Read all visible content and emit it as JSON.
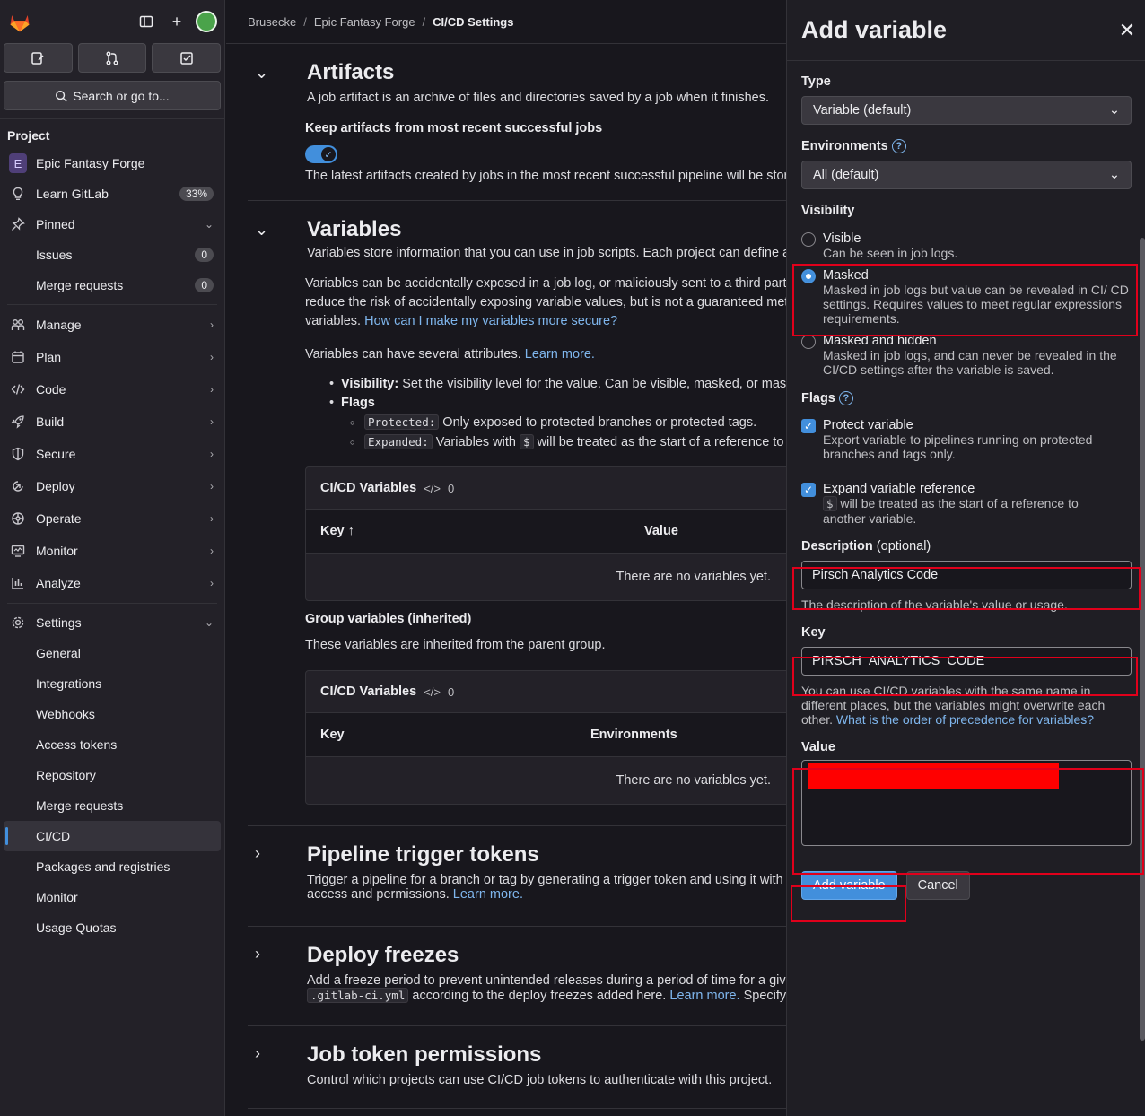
{
  "sidebar": {
    "search_label": "Search or go to...",
    "section_title": "Project",
    "project_name": "Epic Fantasy Forge",
    "project_letter": "E",
    "learn": {
      "label": "Learn GitLab",
      "badge": "33%"
    },
    "pinned": {
      "label": "Pinned",
      "items": [
        {
          "label": "Issues",
          "badge": "0"
        },
        {
          "label": "Merge requests",
          "badge": "0"
        }
      ]
    },
    "groups": [
      "Manage",
      "Plan",
      "Code",
      "Build",
      "Secure",
      "Deploy",
      "Operate",
      "Monitor",
      "Analyze"
    ],
    "settings": {
      "label": "Settings",
      "items": [
        "General",
        "Integrations",
        "Webhooks",
        "Access tokens",
        "Repository",
        "Merge requests",
        "CI/CD",
        "Packages and registries",
        "Monitor",
        "Usage Quotas"
      ]
    },
    "active_item": "CI/CD"
  },
  "breadcrumb": [
    "Brusecke",
    "Epic Fantasy Forge",
    "CI/CD Settings"
  ],
  "artifacts": {
    "title": "Artifacts",
    "desc": "A job artifact is an archive of files and directories saved by a job when it finishes.",
    "keep_label": "Keep artifacts from most recent successful jobs",
    "keep_help": "The latest artifacts created by jobs in the most recent successful pipeline will be stor"
  },
  "variables": {
    "title": "Variables",
    "desc": "Variables store information that you can use in job scripts. Each project can define a",
    "p1_line1": "Variables can be accidentally exposed in a job log, or maliciously sent to a third party",
    "p1_line2": "reduce the risk of accidentally exposing variable values, but is not a guaranteed meth",
    "p1_line3_pre": "variables.",
    "p1_link": "How can I make my variables more secure?",
    "p2_pre": "Variables can have several attributes.",
    "p2_link": "Learn more.",
    "attr_visibility_b": "Visibility:",
    "attr_visibility": "Set the visibility level for the value. Can be visible, masked, or maske",
    "attr_flags": "Flags",
    "flag_protected_code": "Protected:",
    "flag_protected": "Only exposed to protected branches or protected tags.",
    "flag_expanded_code": "Expanded:",
    "flag_expanded_pre": "Variables with",
    "flag_expanded_code2": "$",
    "flag_expanded_post": "will be treated as the start of a reference to",
    "table1": {
      "title": "CI/CD Variables",
      "count": "0",
      "col_key": "Key ↑",
      "col_value": "Value",
      "empty": "There are no variables yet."
    },
    "group_title": "Group variables (inherited)",
    "group_desc": "These variables are inherited from the parent group.",
    "table2": {
      "title": "CI/CD Variables",
      "count": "0",
      "col_key": "Key",
      "col_env": "Environments",
      "empty": "There are no variables yet."
    }
  },
  "pipeline_tokens": {
    "title": "Pipeline trigger tokens",
    "line1": "Trigger a pipeline for a branch or tag by generating a trigger token and using it with a",
    "line2_pre": "access and permissions.",
    "line2_link": "Learn more."
  },
  "deploy_freezes": {
    "title": "Deploy freezes",
    "line1": "Add a freeze period to prevent unintended releases during a period of time for a give",
    "code": ".gitlab-ci.yml",
    "line2_mid": "according to the deploy freezes added here.",
    "line2_link": "Learn more.",
    "line2_post": "Specify c"
  },
  "job_token": {
    "title": "Job token permissions",
    "desc": "Control which projects can use CI/CD job tokens to authenticate with this project."
  },
  "drawer": {
    "title": "Add variable",
    "type_label": "Type",
    "type_value": "Variable (default)",
    "env_label": "Environments",
    "env_value": "All (default)",
    "visibility_label": "Visibility",
    "vis_visible": "Visible",
    "vis_visible_desc": "Can be seen in job logs.",
    "vis_masked": "Masked",
    "vis_masked_desc": "Masked in job logs but value can be revealed in CI/ CD settings. Requires values to meet regular expressions requirements.",
    "vis_hidden": "Masked and hidden",
    "vis_hidden_desc": "Masked in job logs, and can never be revealed in the CI/CD settings after the variable is saved.",
    "flags_label": "Flags",
    "flag_protect": "Protect variable",
    "flag_protect_desc": "Export variable to pipelines running on protected branches and tags only.",
    "flag_expand": "Expand variable reference",
    "flag_expand_code": "$",
    "flag_expand_desc": "will be treated as the start of a reference to another variable.",
    "desc_label": "Description",
    "desc_optional": "(optional)",
    "desc_value": "Pirsch Analytics Code",
    "desc_help": "The description of the variable's value or usage.",
    "key_label": "Key",
    "key_value": "PIRSCH_ANALYTICS_CODE",
    "key_help": "You can use CI/CD variables with the same name in different places, but the variables might overwrite each other.",
    "key_help_link": "What is the order of precedence for variables?",
    "value_label": "Value",
    "add_button": "Add variable",
    "cancel_button": "Cancel"
  },
  "colors": {
    "accent": "#428fdc",
    "highlight": "#e0001b",
    "redaction": "#ff0000"
  }
}
